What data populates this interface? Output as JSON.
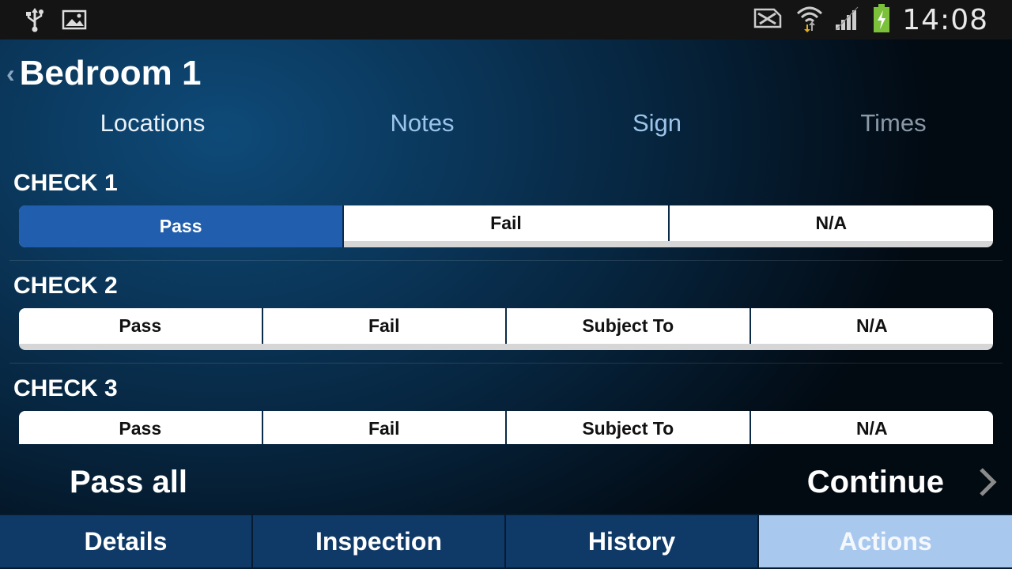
{
  "status_bar": {
    "time": "14:08",
    "icons": [
      "usb-icon",
      "image-icon",
      "no-sim-icon",
      "wifi-icon",
      "signal-icon",
      "battery-charging-icon"
    ]
  },
  "header": {
    "title": "Bedroom 1",
    "back_icon": "chevron-left-icon"
  },
  "tabs": [
    {
      "label": "Locations"
    },
    {
      "label": "Notes"
    },
    {
      "label": "Sign"
    },
    {
      "label": "Times"
    }
  ],
  "checks": [
    {
      "title": "CHECK 1",
      "options": [
        "Pass",
        "Fail",
        "N/A"
      ],
      "selected": "Pass"
    },
    {
      "title": "CHECK 2",
      "options": [
        "Pass",
        "Fail",
        "Subject To",
        "N/A"
      ],
      "selected": null
    },
    {
      "title": "CHECK 3",
      "options": [
        "Pass",
        "Fail",
        "Subject To",
        "N/A"
      ],
      "selected": null
    }
  ],
  "footer": {
    "pass_all_label": "Pass all",
    "continue_label": "Continue",
    "continue_icon": "chevron-right-icon"
  },
  "bottom_nav": [
    {
      "label": "Details"
    },
    {
      "label": "Inspection"
    },
    {
      "label": "History"
    },
    {
      "label": "Actions",
      "active": true
    }
  ],
  "colors": {
    "selected_option": "#215fae",
    "nav_tab": "#0f3a68",
    "nav_tab_active": "#a9c8ee",
    "battery": "#7cc13a"
  }
}
